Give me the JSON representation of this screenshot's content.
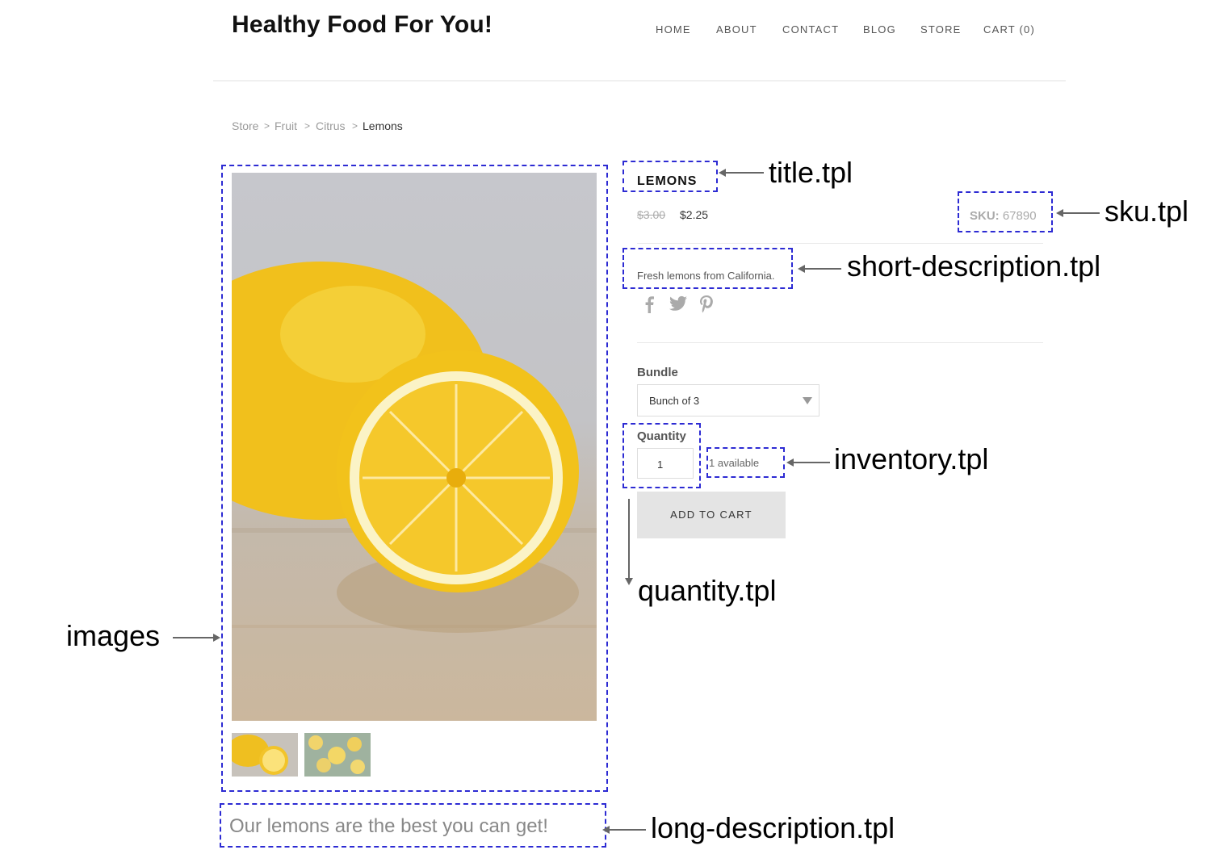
{
  "header": {
    "site_title": "Healthy Food For You!",
    "nav": [
      "HOME",
      "ABOUT",
      "CONTACT",
      "BLOG",
      "STORE",
      "CART (0)"
    ]
  },
  "breadcrumb": {
    "items": [
      "Store",
      "Fruit",
      "Citrus",
      "Lemons"
    ],
    "separator": ">"
  },
  "product": {
    "title": "LEMONS",
    "old_price": "$3.00",
    "price": "$2.25",
    "sku_label": "SKU:",
    "sku_value": "67890",
    "short_description": "Fresh lemons from California.",
    "social_icons": [
      "facebook-icon",
      "twitter-icon",
      "pinterest-icon"
    ],
    "bundle_label": "Bundle",
    "bundle_selected": "Bunch of 3",
    "quantity_label": "Quantity",
    "quantity_value": "1",
    "inventory": "1 available",
    "add_to_cart": "ADD TO CART",
    "long_description": "Our lemons are the best you can get!"
  },
  "annotations": {
    "title": "title.tpl",
    "sku": "sku.tpl",
    "short_description": "short-description.tpl",
    "inventory": "inventory.tpl",
    "quantity": "quantity.tpl",
    "images": "images",
    "long_description": "long-description.tpl"
  },
  "colors": {
    "annotation_dash": "#2d2bd3",
    "button_bg": "#e4e4e4",
    "lemon": "#f2c21b"
  }
}
